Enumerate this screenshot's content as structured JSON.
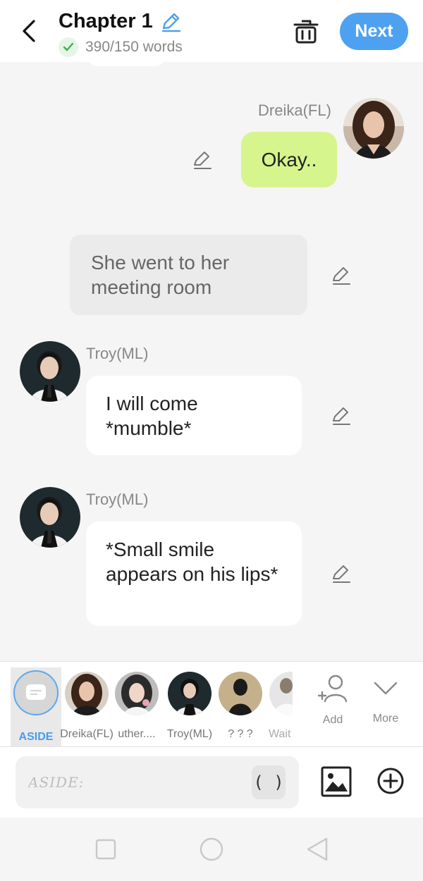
{
  "header": {
    "title": "Chapter 1",
    "word_count": "390/150 words",
    "next_label": "Next"
  },
  "chat": {
    "messages": [
      {
        "speaker": "Dreika(FL)",
        "text": "Okay..",
        "side": "right"
      },
      {
        "type": "narration",
        "text": "She went to her meeting room"
      },
      {
        "speaker": "Troy(ML)",
        "text": "I will come *mumble*",
        "side": "left"
      },
      {
        "speaker": "Troy(ML)",
        "text": "*Small smile appears on his lips*",
        "side": "left"
      }
    ]
  },
  "characters": {
    "items": [
      {
        "label": "ASIDE",
        "selected": true
      },
      {
        "label": "Dreika(FL)"
      },
      {
        "label": "uther...."
      },
      {
        "label": "Troy(ML)"
      },
      {
        "label": "? ? ?"
      },
      {
        "label": "Wait"
      }
    ],
    "add_label": "Add",
    "more_label": "More"
  },
  "input": {
    "placeholder": "ASIDE:",
    "paren_label": "( )"
  },
  "colors": {
    "accent": "#4da1f0",
    "bubble_green": "#d6f58d",
    "narration_bg": "#ebebeb"
  }
}
